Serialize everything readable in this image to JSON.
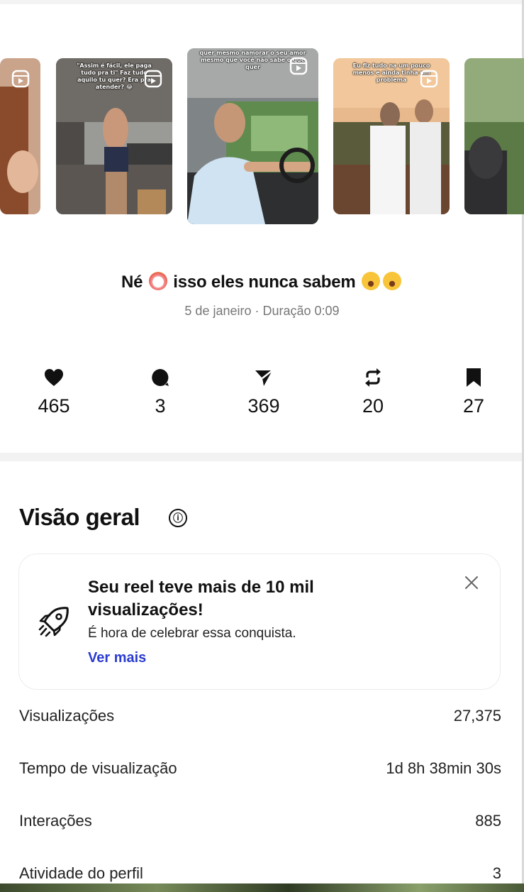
{
  "carousel": [
    {
      "caption": ""
    },
    {
      "caption": "\"Assim é fácil, ele paga tudo pra ti\" Faz tudo aquilo tu quer? Era pra atender? 😂"
    },
    {
      "caption": "quer mesmo namorar o seu amor mesmo que você não sabe o que quer"
    },
    {
      "caption": "Eu fiz tudo na um pouco menos e ainda tinha um problema"
    },
    {
      "caption": ""
    }
  ],
  "reel": {
    "title_before": "Né",
    "title_text": "isso eles nunca sabem",
    "meta": "5 de janeiro · Duração 0:09"
  },
  "stats": [
    {
      "icon": "heart-icon",
      "value": "465"
    },
    {
      "icon": "comment-icon",
      "value": "3"
    },
    {
      "icon": "share-icon",
      "value": "369"
    },
    {
      "icon": "repost-icon",
      "value": "20"
    },
    {
      "icon": "bookmark-icon",
      "value": "27"
    }
  ],
  "overview": {
    "title": "Visão geral",
    "info_icon": "ⓘ",
    "card": {
      "title": "Seu reel teve mais de 10 mil visualizações!",
      "subtitle": "É hora de celebrar essa conquista.",
      "link": "Ver mais"
    },
    "rows": [
      {
        "label": "Visualizações",
        "value": "27,375"
      },
      {
        "label": "Tempo de visualização",
        "value": "1d 8h 38min 30s"
      },
      {
        "label": "Interações",
        "value": "885"
      },
      {
        "label": "Atividade do perfil",
        "value": "3"
      }
    ]
  },
  "colors": {
    "link": "#2a3bd1",
    "muted": "#777777",
    "divider": "#f2f2f2"
  }
}
